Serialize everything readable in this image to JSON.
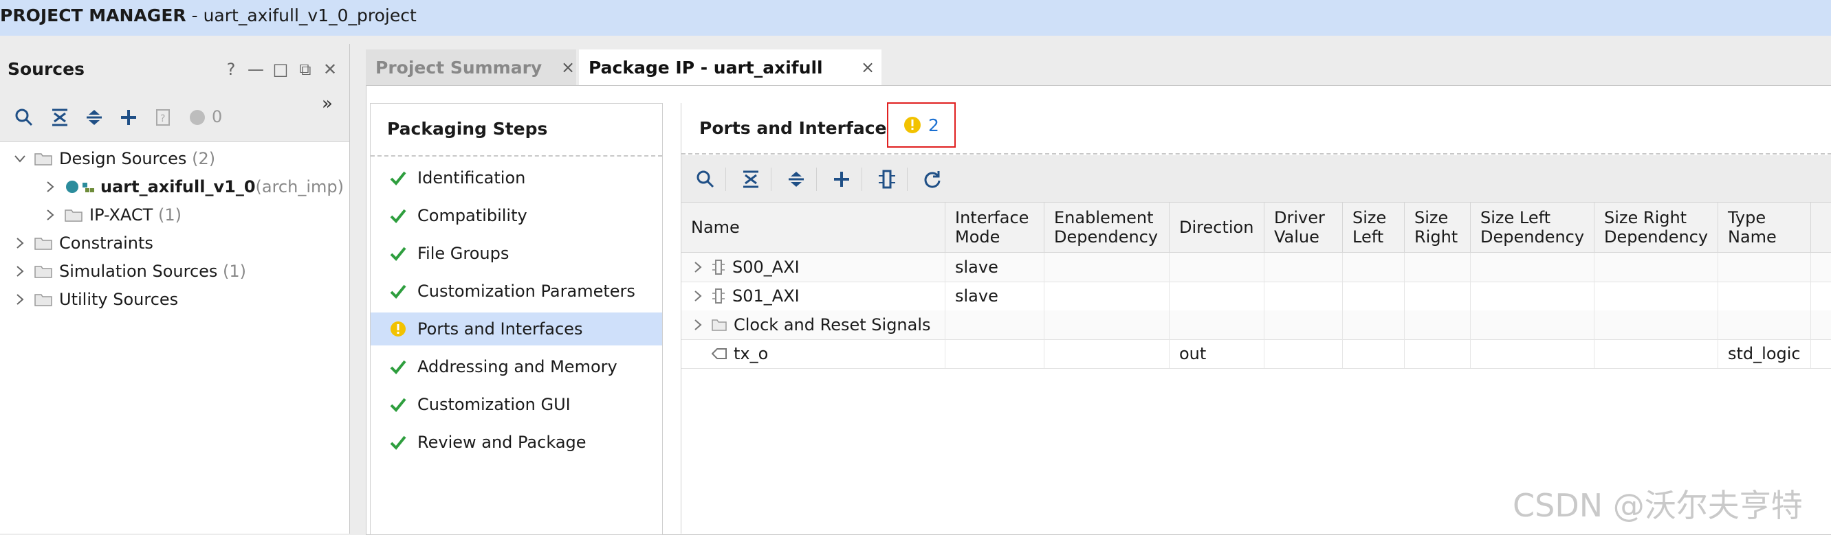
{
  "titlebar": {
    "section": "PROJECT MANAGER",
    "project": " - uart_axifull_v1_0_project"
  },
  "sources": {
    "title": "Sources",
    "header_icons": [
      "help-icon",
      "minimize-icon",
      "maximize-icon",
      "float-icon",
      "close-icon"
    ],
    "status_count": "0",
    "tree": [
      {
        "label": "Design Sources",
        "count": "(2)"
      },
      {
        "label": "uart_axifull_v1_0",
        "suffix": "(arch_imp)"
      },
      {
        "label": "IP-XACT",
        "count": "(1)"
      },
      {
        "label": "Constraints",
        "count": ""
      },
      {
        "label": "Simulation Sources",
        "count": "(1)"
      },
      {
        "label": "Utility Sources",
        "count": ""
      }
    ]
  },
  "tabs": [
    {
      "label": "Project Summary",
      "active": false
    },
    {
      "label": "Package IP - uart_axifull",
      "active": true
    }
  ],
  "steps": {
    "title": "Packaging Steps",
    "items": [
      {
        "label": "Identification",
        "status": "ok"
      },
      {
        "label": "Compatibility",
        "status": "ok"
      },
      {
        "label": "File Groups",
        "status": "ok"
      },
      {
        "label": "Customization Parameters",
        "status": "ok"
      },
      {
        "label": "Ports and Interfaces",
        "status": "warning"
      },
      {
        "label": "Addressing and Memory",
        "status": "ok"
      },
      {
        "label": "Customization GUI",
        "status": "ok"
      },
      {
        "label": "Review and Package",
        "status": "ok"
      }
    ]
  },
  "ports": {
    "title": "Ports and Interfaces",
    "warning_count": "2",
    "columns": [
      "Name",
      "Interface\nMode",
      "Enablement\nDependency",
      "Direction",
      "Driver\nValue",
      "Size\nLeft",
      "Size\nRight",
      "Size Left\nDependency",
      "Size Right\nDependency",
      "Type\nName"
    ],
    "rows": [
      {
        "name": "S00_AXI",
        "kind": "interface",
        "cells": [
          "slave",
          "",
          "",
          "",
          "",
          "",
          "",
          "",
          ""
        ]
      },
      {
        "name": "S01_AXI",
        "kind": "interface",
        "cells": [
          "slave",
          "",
          "",
          "",
          "",
          "",
          "",
          "",
          ""
        ]
      },
      {
        "name": "Clock and Reset Signals",
        "kind": "folder",
        "cells": [
          "",
          "",
          "",
          "",
          "",
          "",
          "",
          "",
          ""
        ]
      },
      {
        "name": "tx_o",
        "kind": "port",
        "cells": [
          "",
          "",
          "out",
          "",
          "",
          "",
          "",
          "",
          "std_logic"
        ]
      }
    ]
  },
  "watermark": "CSDN @沃尔夫亨特",
  "colors": {
    "accent": "#1a6fd1",
    "selection": "#cfe0fa",
    "ok": "#2e9e3e",
    "warning": "#f2c200",
    "highlight_box": "#e02020"
  }
}
